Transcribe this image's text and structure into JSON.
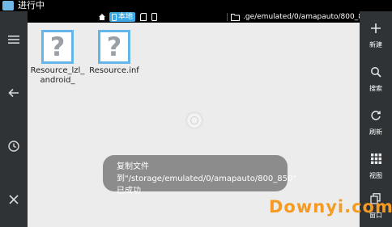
{
  "statusbar": {
    "title": "进行中"
  },
  "toolbar": {
    "local_label": "本地",
    "path": ".ge/emulated/0/amapauto/800_850"
  },
  "left_rail": {
    "icons": [
      "menu-icon",
      "back-arrow-icon",
      "history-icon",
      "close-icon"
    ]
  },
  "right_rail": {
    "actions": [
      {
        "label": "新建",
        "icon": "plus-icon"
      },
      {
        "label": "搜索",
        "icon": "search-icon"
      },
      {
        "label": "刷新",
        "icon": "refresh-icon"
      },
      {
        "label": "视图",
        "icon": "grid-icon"
      },
      {
        "label": "窗口",
        "icon": "windows-icon"
      }
    ]
  },
  "files": [
    {
      "name": "Resource_lzl_android_"
    },
    {
      "name": "Resource.inf"
    }
  ],
  "toast": {
    "text": "复制文件到\"/storage/emulated/0/amapauto/800_850\" 已成功"
  },
  "watermark": {
    "text": "Downyi.com"
  },
  "colors": {
    "accent": "#3aa9e8",
    "rail": "#2f3336",
    "watermark": "#f59a23"
  }
}
